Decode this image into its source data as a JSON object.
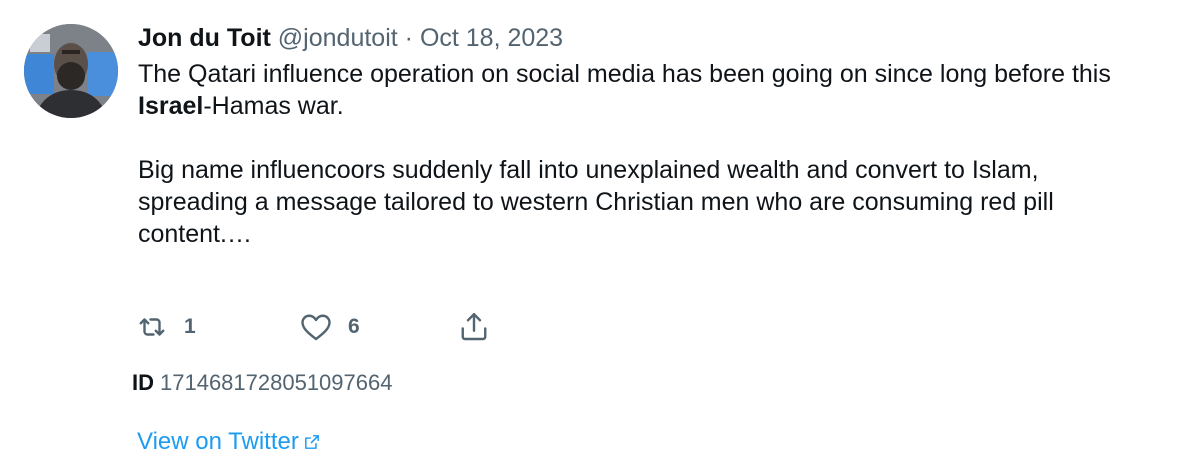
{
  "author": {
    "name": "Jon du Toit",
    "handle": "@jondutoit",
    "separator": "·",
    "date": "Oct 18, 2023"
  },
  "body": {
    "p1_before": "The Qatari influence operation on social media has been going on since long before this ",
    "p1_bold": "Israel",
    "p1_after": "-Hamas war.",
    "p2": "Big name influencoors suddenly fall into unexplained wealth and convert to Islam, spreading a message tailored to western Christian men who are consuming red pill content.…"
  },
  "actions": {
    "retweet_icon": "retweet-icon",
    "retweet_count": "1",
    "like_icon": "heart-icon",
    "like_count": "6",
    "share_icon": "share-icon"
  },
  "tweet_id": {
    "label": "ID",
    "value": "1714681728051097664"
  },
  "link": {
    "label": "View on Twitter",
    "icon": "external-link-icon"
  },
  "colors": {
    "text": "#0f1419",
    "muted": "#536471",
    "link": "#1d9bf0"
  }
}
